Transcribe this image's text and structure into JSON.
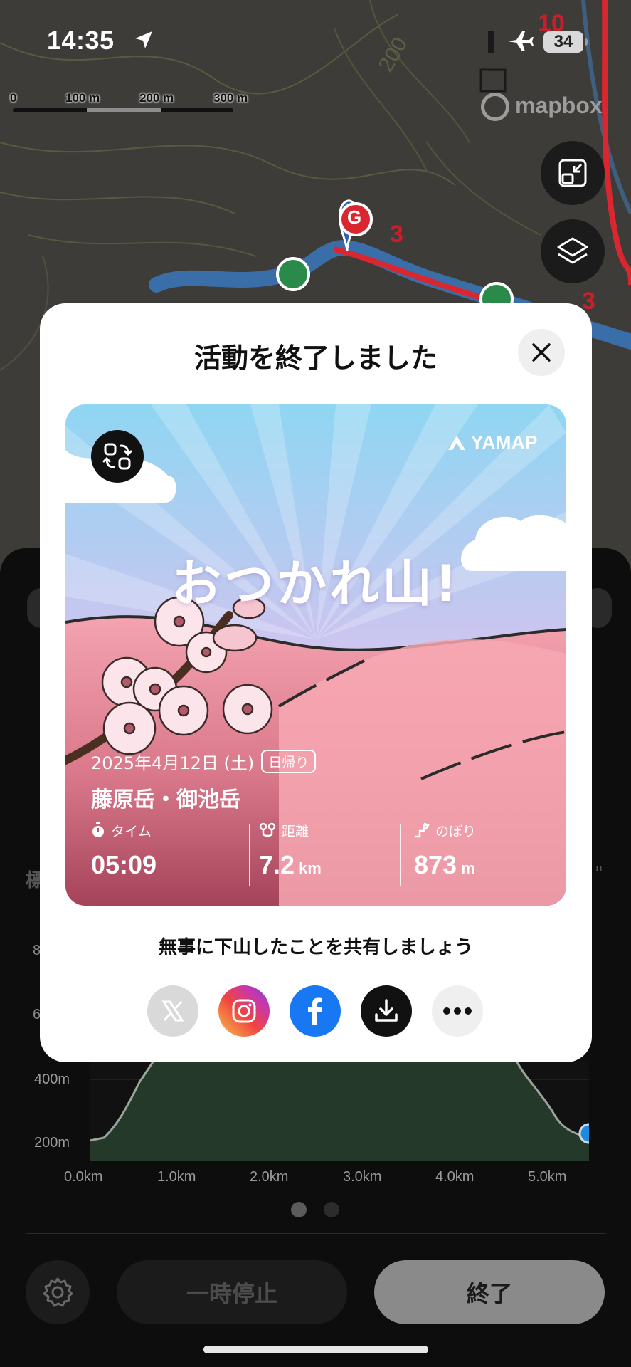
{
  "status_bar": {
    "time": "14:35",
    "battery": "34"
  },
  "map": {
    "scale_labels": [
      "0",
      "100 m",
      "200 m",
      "300 m"
    ],
    "attribution": "mapbox",
    "route_numbers": [
      "10",
      "3",
      "3"
    ],
    "start_marker": "G",
    "contour_label": "200"
  },
  "modal": {
    "title": "活動を終了しました",
    "card": {
      "brand": "YAMAP",
      "headline": "おつかれ山!",
      "date": "2025年4月12日 (土)",
      "trip_type": "日帰り",
      "mountain": "藤原岳・御池岳",
      "stats": [
        {
          "label": "タイム",
          "value": "05:09",
          "unit": ""
        },
        {
          "label": "距離",
          "value": "7.2",
          "unit": "km"
        },
        {
          "label": "のぼり",
          "value": "873",
          "unit": "m"
        }
      ]
    },
    "share_prompt": "無事に下山したことを共有しましょう",
    "share_targets": [
      "x",
      "instagram",
      "facebook",
      "download",
      "more"
    ]
  },
  "panel": {
    "partial_labels": {
      "left": "標",
      "right": "\""
    },
    "axis_fragments": [
      "8",
      "6"
    ],
    "elevation_y_labels": [
      "400m",
      "200m"
    ],
    "elevation_x_labels": [
      "0.0km",
      "1.0km",
      "2.0km",
      "3.0km",
      "4.0km",
      "5.0km"
    ],
    "pause_label": "一時停止",
    "end_label": "終了"
  },
  "colors": {
    "accent_blue": "#1877f2",
    "route_red": "#d9262f",
    "card_pink": "#e88a99"
  }
}
